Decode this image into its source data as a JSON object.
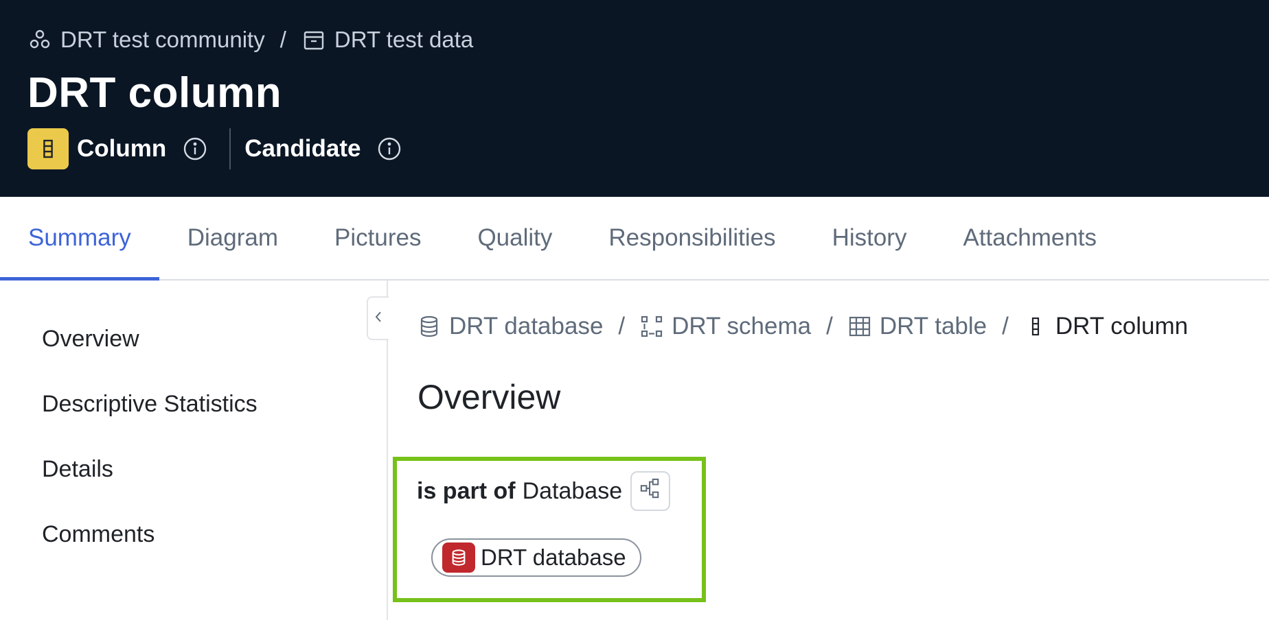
{
  "header": {
    "breadcrumb": [
      {
        "label": "DRT test community",
        "icon": "community-icon"
      },
      {
        "label": "DRT test data",
        "icon": "domain-icon"
      }
    ],
    "separator": "/",
    "title": "DRT column",
    "asset_type": "Column",
    "status": "Candidate",
    "type_badge_color": "#ebc94a"
  },
  "tabs": [
    {
      "label": "Summary",
      "active": true
    },
    {
      "label": "Diagram"
    },
    {
      "label": "Pictures"
    },
    {
      "label": "Quality"
    },
    {
      "label": "Responsibilities"
    },
    {
      "label": "History"
    },
    {
      "label": "Attachments"
    }
  ],
  "sidebar": {
    "items": [
      {
        "label": "Overview"
      },
      {
        "label": "Descriptive Statistics"
      },
      {
        "label": "Details"
      },
      {
        "label": "Comments"
      }
    ]
  },
  "main": {
    "breadcrumb": [
      {
        "label": "DRT database",
        "icon": "database-icon"
      },
      {
        "label": "DRT schema",
        "icon": "schema-icon"
      },
      {
        "label": "DRT table",
        "icon": "table-icon"
      },
      {
        "label": "DRT column",
        "icon": "column-icon"
      }
    ],
    "separator": "/",
    "section_title": "Overview",
    "relation": {
      "label": "is part of",
      "target_type": "Database",
      "chip_label": "DRT database",
      "chip_icon_color": "#c0282d",
      "highlight_color": "#76c11a"
    }
  },
  "colors": {
    "header_bg": "#0b1625",
    "accent": "#3d64d8"
  }
}
